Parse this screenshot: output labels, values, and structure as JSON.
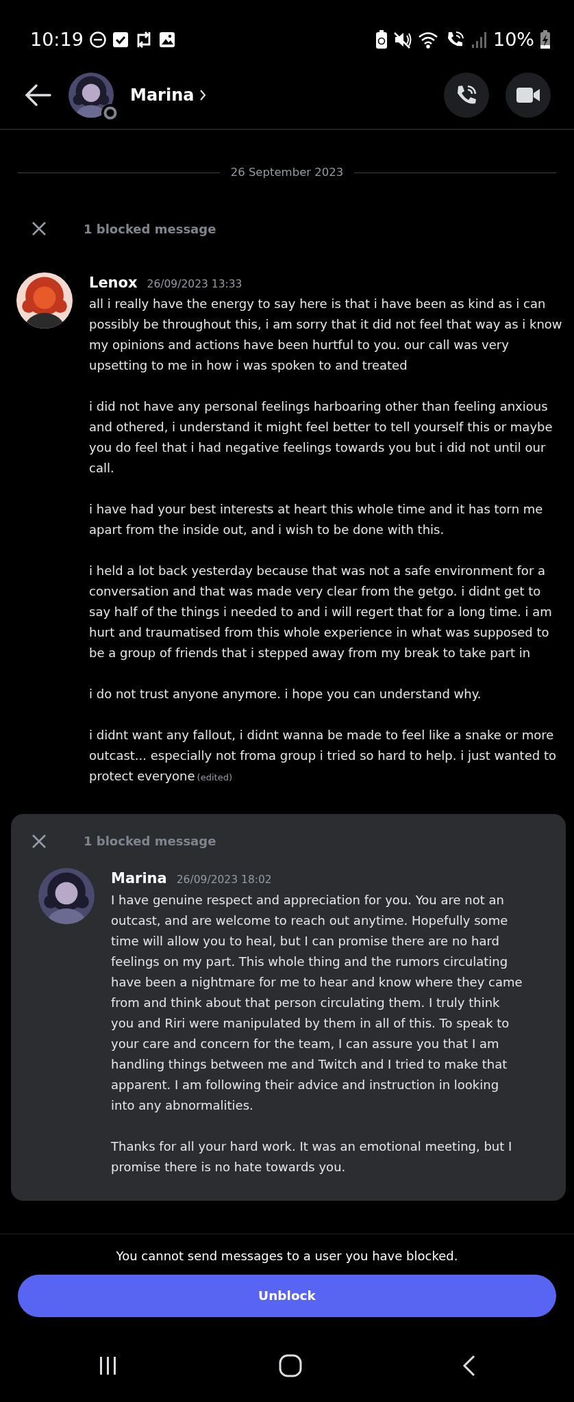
{
  "status_bar": {
    "time": "10:19",
    "battery": "10%"
  },
  "header": {
    "name": "Marina"
  },
  "date_divider": "26 September 2023",
  "feed": [
    {
      "kind": "blocked",
      "label": "1 blocked message"
    },
    {
      "kind": "message",
      "author": "Lenox",
      "timestamp": "26/09/2023 13:33",
      "paragraphs": [
        "all i really have the energy to say here is that i have been as kind as i can possibly be throughout this, i am sorry that it did not feel that way as i know my opinions and actions have been hurtful to you. our call was very upsetting to me in how i was spoken to and treated",
        "i did not have any personal feelings harboaring other than feeling anxious and othered, i understand it might feel better to tell yourself this or maybe you do feel that i had negative feelings towards you but i did not until our call.",
        "i have had your best interests at heart this whole time and it has torn me apart from the inside out, and i wish to be done with this.",
        "i held a lot back yesterday because that was not a safe environment for a conversation and that was made very clear from the getgo. i didnt get to say half of the things i needed to and i will regert that for a long time. i am hurt and traumatised from this whole experience in what was supposed to be a group of friends that i stepped away from my break to take part in",
        "i do not trust anyone anymore. i hope you can understand why.",
        "i didnt want any fallout, i didnt wanna be made to feel like a snake or more outcast... especially not froma  group i tried so hard to help. i just wanted to protect everyone"
      ],
      "edited": "(edited)"
    },
    {
      "kind": "blocked",
      "label": "1 blocked message",
      "messages": [
        {
          "author": "Marina",
          "timestamp": "26/09/2023 18:02",
          "paragraphs": [
            "I have genuine respect and appreciation for you. You are not an outcast, and are welcome to reach out anytime. Hopefully some time will allow you to heal, but I can promise there are no hard feelings on my part. This whole thing and the rumors circulating have been a nightmare for me to hear and know where they came from and think about that person circulating them. I truly think you and Riri were manipulated by them in all of this. To speak to your care and concern for the team, I can assure you that I am handling things between me and Twitch and I tried to make that apparent. I am following their advice and instruction in looking into any abnormalities.",
            "Thanks for all your hard work. It was an emotional meeting, but I promise there is no hate towards you."
          ]
        }
      ]
    }
  ],
  "footer": {
    "notice": "You cannot send messages to a user you have blocked.",
    "button": "Unblock"
  }
}
